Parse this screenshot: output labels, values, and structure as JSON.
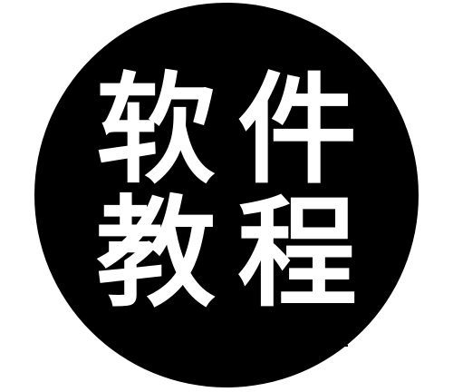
{
  "logo": {
    "line1": "软件",
    "line2": "教程",
    "colors": {
      "background": "#ffffff",
      "circle": "#000000",
      "text": "#ffffff"
    }
  }
}
